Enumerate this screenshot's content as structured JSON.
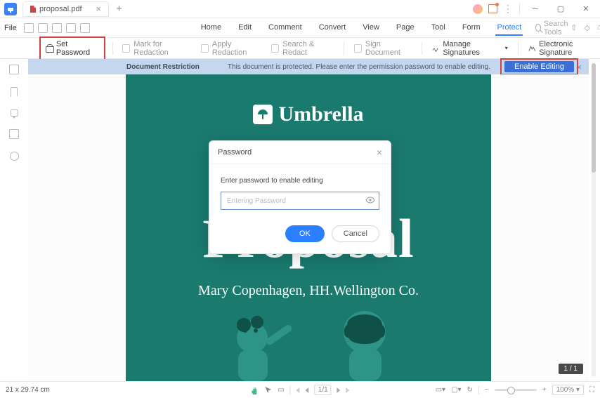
{
  "title_tab": "proposal.pdf",
  "menu_file": "File",
  "topmenu": {
    "home": "Home",
    "edit": "Edit",
    "comment": "Comment",
    "convert": "Convert",
    "view": "View",
    "page": "Page",
    "tool": "Tool",
    "form": "Form",
    "protect": "Protect"
  },
  "search_tools": "Search Tools",
  "toolbar": {
    "set_password": "Set Password",
    "mark_for_redaction": "Mark for Redaction",
    "apply_redaction": "Apply Redaction",
    "search_redact": "Search & Redact",
    "sign_document": "Sign Document",
    "manage_signatures": "Manage Signatures",
    "electronic_signature": "Electronic Signature"
  },
  "banner": {
    "title": "Document Restriction",
    "msg": "This document is protected. Please enter the permission password to enable editing.",
    "btn": "Enable Editing"
  },
  "doc": {
    "brand": "Umbrella",
    "title": "Proposal",
    "subtitle": "Mary Copenhagen, HH.Wellington Co."
  },
  "modal": {
    "title": "Password",
    "msg": "Enter password to enable editing",
    "placeholder": "Entering Password",
    "ok": "OK",
    "cancel": "Cancel"
  },
  "status": {
    "dim": "21 x 29.74 cm",
    "page": "1",
    "total": "/1",
    "zoom": "100%"
  },
  "page_badge": "1 / 1"
}
